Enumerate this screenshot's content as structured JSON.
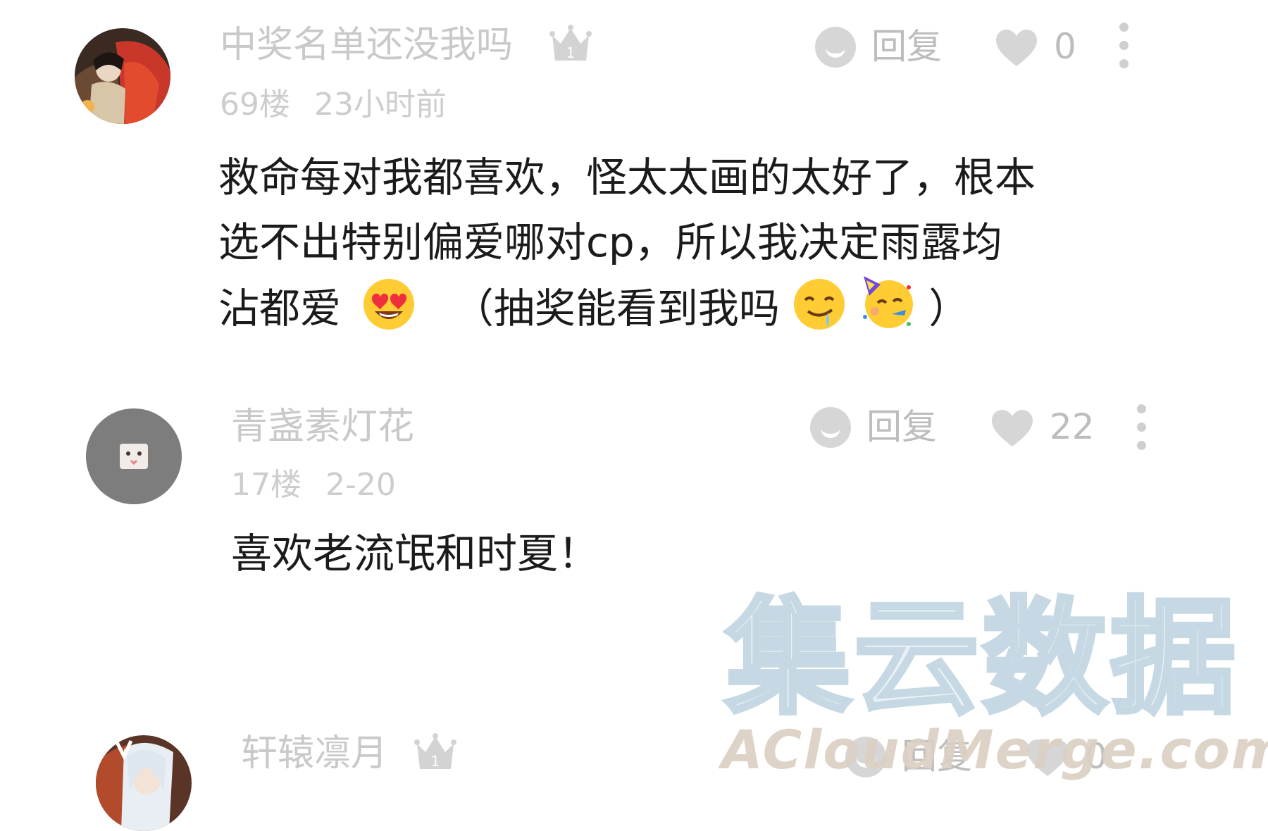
{
  "comments": [
    {
      "username": "中奖名单还没我吗",
      "floor": "69楼",
      "time": "23小时前",
      "badge": "1",
      "reply_label": "回复",
      "likes": "0",
      "text_lines": [
        "救命每对我都喜欢，怪太太画的太好了，根本",
        "选不出特别偏爱哪对cp，所以我决定雨露均",
        "沾都爱",
        "（抽奖能看到我吗",
        "）"
      ],
      "emojis": [
        "heart-eyes-emoji",
        "drooling-face-emoji",
        "partying-face-emoji"
      ]
    },
    {
      "username": "青盏素灯花",
      "floor": "17楼",
      "time": "2-20",
      "reply_label": "回复",
      "likes": "22",
      "text_lines": [
        "喜欢老流氓和时夏！"
      ]
    },
    {
      "username": "轩辕凛月",
      "badge": "1",
      "reply_label": "回复",
      "likes": "0"
    }
  ],
  "watermark": {
    "chinese": "集云数据",
    "english": "ACloudMerge.com"
  },
  "colors": {
    "username": "#c9c9c9",
    "meta": "#cdcdcd",
    "body_text": "#1b1b1b",
    "icon_gray": "#d6d6d6"
  }
}
